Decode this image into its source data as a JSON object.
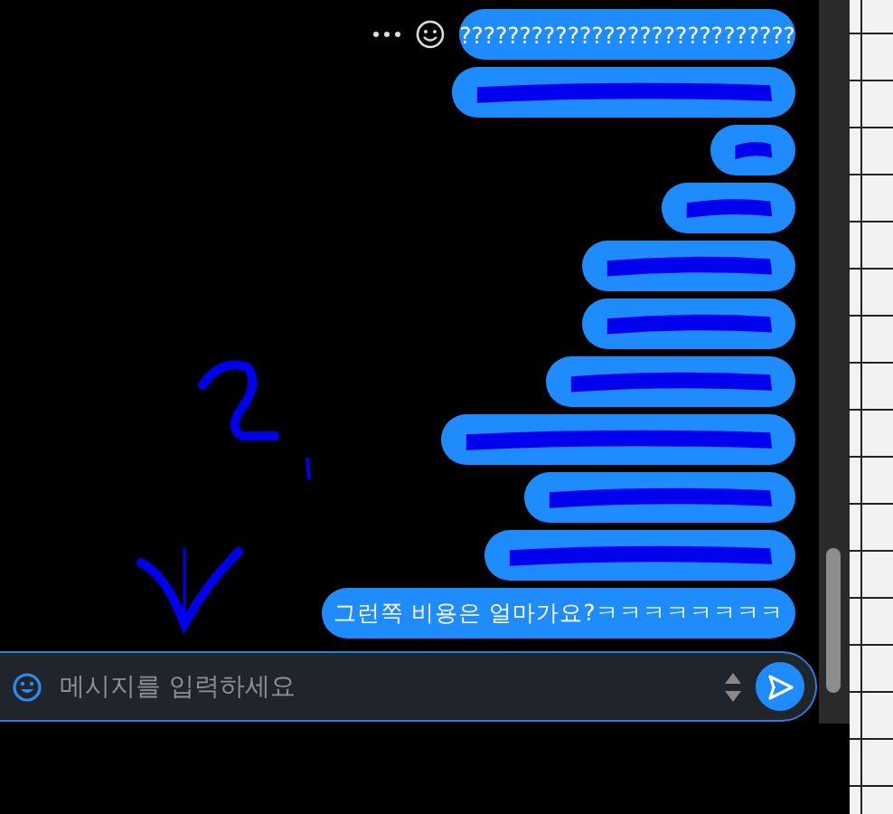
{
  "messages": [
    {
      "kind": "text",
      "text": "????????????????????????????",
      "actions": true
    },
    {
      "kind": "redacted"
    },
    {
      "kind": "redacted"
    },
    {
      "kind": "redacted"
    },
    {
      "kind": "redacted"
    },
    {
      "kind": "redacted"
    },
    {
      "kind": "redacted"
    },
    {
      "kind": "redacted"
    },
    {
      "kind": "redacted"
    },
    {
      "kind": "redacted"
    },
    {
      "kind": "text",
      "text": "그런쪽 비용은 얼마가요?ㅋㅋㅋㅋㅋㅋㅋㅋ"
    }
  ],
  "composer": {
    "placeholder": "메시지를 입력하세요"
  }
}
